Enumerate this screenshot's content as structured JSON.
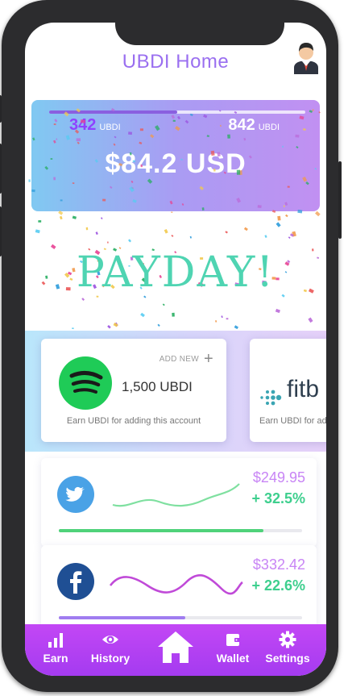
{
  "header": {
    "title": "UBDI Home",
    "avatar_icon": "user-avatar-icon"
  },
  "banner": {
    "progress_fraction": 0.5,
    "current_points": "342",
    "max_points": "842",
    "unit": "UBDI",
    "usd_value": "$84.2 USD",
    "message": "PAYDAY!"
  },
  "cards": [
    {
      "add_label": "ADD NEW",
      "amount": "1,500 UBDI",
      "note": "Earn  UBDI for adding this account",
      "logo_icon": "spotify-icon"
    },
    {
      "brand_text": "fitb",
      "note": "Earn  UBDI for ad",
      "logo_icon": "fitbit-icon"
    }
  ],
  "accounts": [
    {
      "logo_icon": "twitter-icon",
      "price": "$249.95",
      "change": "+ 32.5%",
      "progress_fraction": 0.84,
      "bar_color": "#4fd27a"
    },
    {
      "logo_icon": "facebook-icon",
      "price": "$332.42",
      "change": "+ 22.6%",
      "progress_fraction": 0.52,
      "bar_color": "#a07df0"
    }
  ],
  "nav": {
    "items": [
      {
        "label": "Earn",
        "icon": "bar-chart-icon"
      },
      {
        "label": "History",
        "icon": "eye-icon"
      },
      {
        "label": "",
        "icon": "home-icon"
      },
      {
        "label": "Wallet",
        "icon": "wallet-icon"
      },
      {
        "label": "Settings",
        "icon": "gear-icon"
      }
    ]
  },
  "colors": {
    "accent": "#9a6ff0",
    "nav": "#b941f3",
    "positive": "#3ecf8e",
    "payday": "#4fd4b2"
  }
}
